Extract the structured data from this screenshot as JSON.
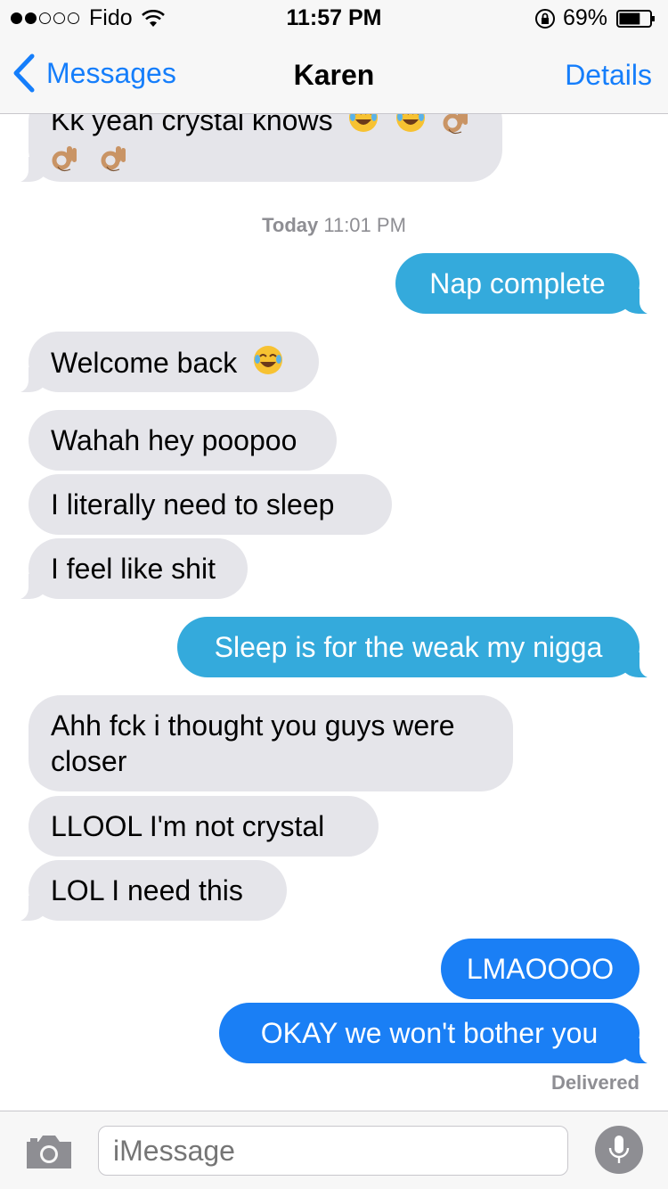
{
  "status_bar": {
    "carrier": "Fido",
    "time": "11:57 PM",
    "battery": "69%",
    "signal_strength": 2,
    "signal_max": 5,
    "battery_level": 0.69
  },
  "nav": {
    "back_label": "Messages",
    "title": "Karen",
    "details_label": "Details"
  },
  "timestamp": {
    "day": "Today",
    "time": "11:01 PM"
  },
  "messages": [
    {
      "direction": "in",
      "text": "Kk yeah crystal knows",
      "emoji": [
        "face-with-tears-of-joy",
        "face-with-tears-of-joy",
        "ok-hand",
        "ok-hand",
        "ok-hand"
      ]
    },
    {
      "direction": "out",
      "text": "Nap complete"
    },
    {
      "direction": "in",
      "text": "Welcome back",
      "emoji": [
        "face-with-tears-of-joy"
      ]
    },
    {
      "direction": "in",
      "text": "Wahah hey poopoo"
    },
    {
      "direction": "in",
      "text": "I literally need to sleep"
    },
    {
      "direction": "in",
      "text": "I feel like shit"
    },
    {
      "direction": "out",
      "text": "Sleep is for the weak my nigga"
    },
    {
      "direction": "in",
      "text": "Ahh fck i thought you guys were closer"
    },
    {
      "direction": "in",
      "text": "LLOOL I'm not crystal"
    },
    {
      "direction": "in",
      "text": "LOL I need this"
    },
    {
      "direction": "out",
      "text": "LMAOOOO"
    },
    {
      "direction": "out",
      "text": "OKAY we won't bother you"
    }
  ],
  "delivery_status": "Delivered",
  "input": {
    "placeholder": "iMessage",
    "value": ""
  },
  "colors": {
    "accent": "#157efb",
    "incoming_bubble": "#e5e5ea",
    "outgoing_bubble_sms_style": "#34aadc",
    "outgoing_bubble": "#1a7ff5",
    "meta_text": "#8e8e93"
  },
  "icons": {
    "back": "chevron-left-icon",
    "camera": "camera-icon",
    "mic": "microphone-icon",
    "wifi": "wifi-icon",
    "lock": "rotation-lock-icon",
    "battery": "battery-icon"
  }
}
